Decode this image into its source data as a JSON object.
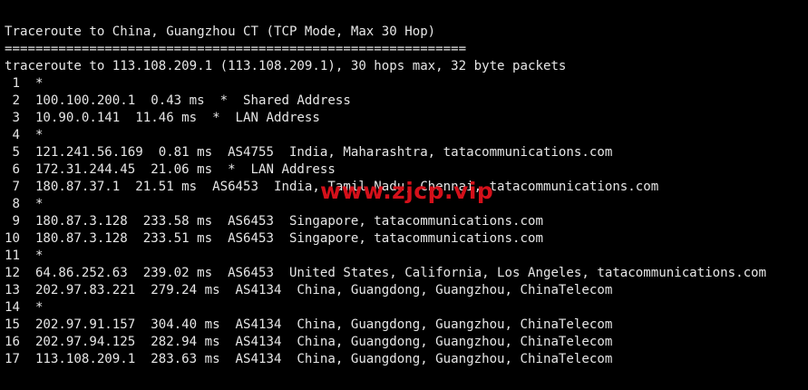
{
  "terminal": {
    "lines": [
      "Traceroute to China, Guangzhou CT (TCP Mode, Max 30 Hop)",
      "============================================================",
      "traceroute to 113.108.209.1 (113.108.209.1), 30 hops max, 32 byte packets",
      " 1  *",
      " 2  100.100.200.1  0.43 ms  *  Shared Address",
      " 3  10.90.0.141  11.46 ms  *  LAN Address",
      " 4  *",
      " 5  121.241.56.169  0.81 ms  AS4755  India, Maharashtra, tatacommunications.com",
      " 6  172.31.244.45  21.06 ms  *  LAN Address",
      " 7  180.87.37.1  21.51 ms  AS6453  India, Tamil Nadu, Chennai, tatacommunications.com",
      " 8  *",
      " 9  180.87.3.128  233.58 ms  AS6453  Singapore, tatacommunications.com",
      "10  180.87.3.128  233.51 ms  AS6453  Singapore, tatacommunications.com",
      "11  *",
      "12  64.86.252.63  239.02 ms  AS6453  United States, California, Los Angeles, tatacommunications.com",
      "13  202.97.83.221  279.24 ms  AS4134  China, Guangdong, Guangzhou, ChinaTelecom",
      "14  *",
      "15  202.97.91.157  304.40 ms  AS4134  China, Guangdong, Guangzhou, ChinaTelecom",
      "16  202.97.94.125  282.94 ms  AS4134  China, Guangdong, Guangzhou, ChinaTelecom",
      "17  113.108.209.1  283.63 ms  AS4134  China, Guangdong, Guangzhou, ChinaTelecom"
    ]
  },
  "watermark": {
    "text": "www.zjcp.vip",
    "color": "#d4101a"
  },
  "colors": {
    "background": "#000000",
    "foreground": "#e6e6e6"
  }
}
